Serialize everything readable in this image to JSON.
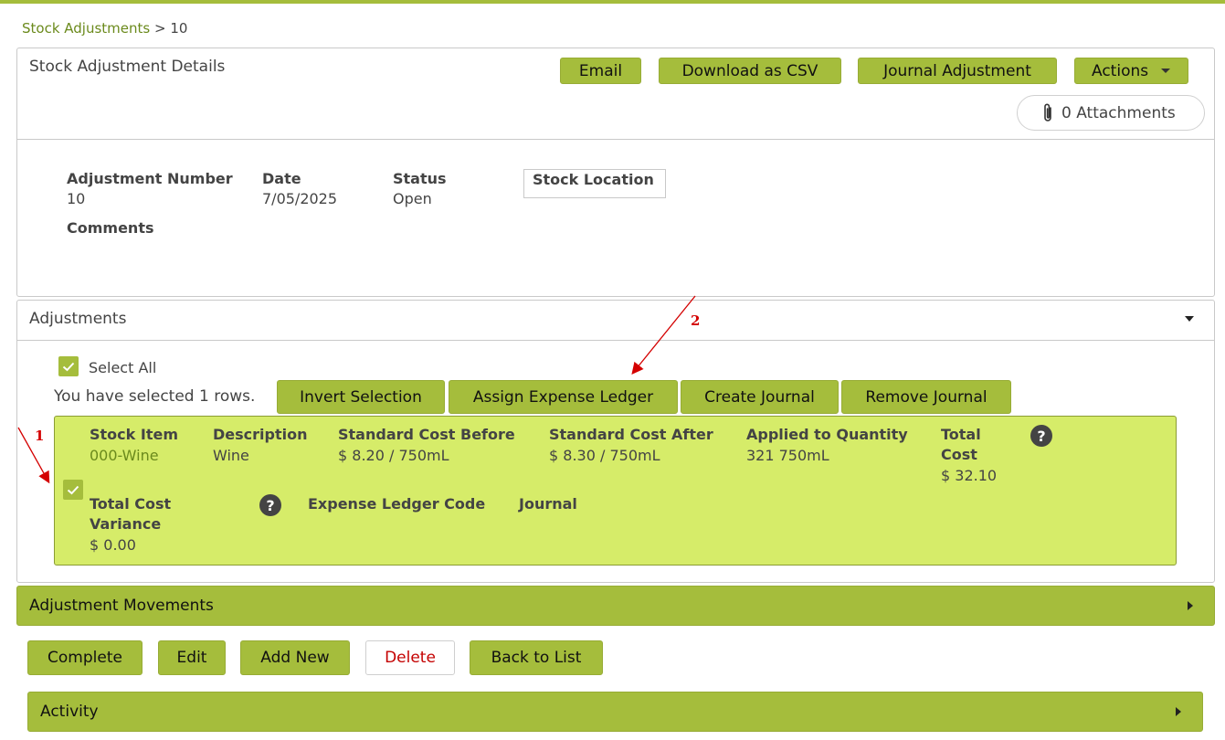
{
  "breadcrumb": {
    "parent": "Stock Adjustments",
    "separator": " > ",
    "current": "10"
  },
  "details": {
    "title": "Stock Adjustment Details",
    "buttons": {
      "email": "Email",
      "download_csv": "Download as CSV",
      "journal_adjustment": "Journal Adjustment",
      "actions": "Actions"
    },
    "attachments": "0 Attachments",
    "fields": {
      "adjustment_number_label": "Adjustment Number",
      "adjustment_number": "10",
      "date_label": "Date",
      "date": "7/05/2025",
      "status_label": "Status",
      "status": "Open",
      "stock_location_label": "Stock Location",
      "comments_label": "Comments"
    }
  },
  "adjustments": {
    "title": "Adjustments",
    "select_all": "Select All",
    "selected_text": "You have selected 1 rows.",
    "buttons": {
      "invert": "Invert Selection",
      "assign_ledger": "Assign Expense Ledger",
      "create_journal": "Create Journal",
      "remove_journal": "Remove Journal"
    },
    "row": {
      "stock_item_label": "Stock Item",
      "stock_item": "000-Wine",
      "description_label": "Description",
      "description": "Wine",
      "cost_before_label": "Standard Cost Before",
      "cost_before": "$ 8.20 / 750mL",
      "cost_after_label": "Standard Cost After",
      "cost_after": "$ 8.30 / 750mL",
      "applied_qty_label": "Applied to Quantity",
      "applied_qty": "321 750mL",
      "total_cost_label_1": "Total",
      "total_cost_label_2": "Cost",
      "total_cost": "$ 32.10",
      "variance_label_1": "Total Cost",
      "variance_label_2": "Variance",
      "variance": "$ 0.00",
      "ledger_label": "Expense Ledger Code",
      "journal_label": "Journal",
      "help_glyph": "?"
    }
  },
  "movements": {
    "title": "Adjustment Movements"
  },
  "footer_buttons": {
    "complete": "Complete",
    "edit": "Edit",
    "add_new": "Add New",
    "delete": "Delete",
    "back": "Back to List"
  },
  "activity": {
    "title": "Activity"
  },
  "annotations": {
    "one": "1",
    "two": "2"
  },
  "colors": {
    "accent": "#a5bd3c",
    "row_highlight": "#d6ec69",
    "link": "#6b8a1c",
    "delete": "#c40000",
    "annotation": "#d40000"
  }
}
